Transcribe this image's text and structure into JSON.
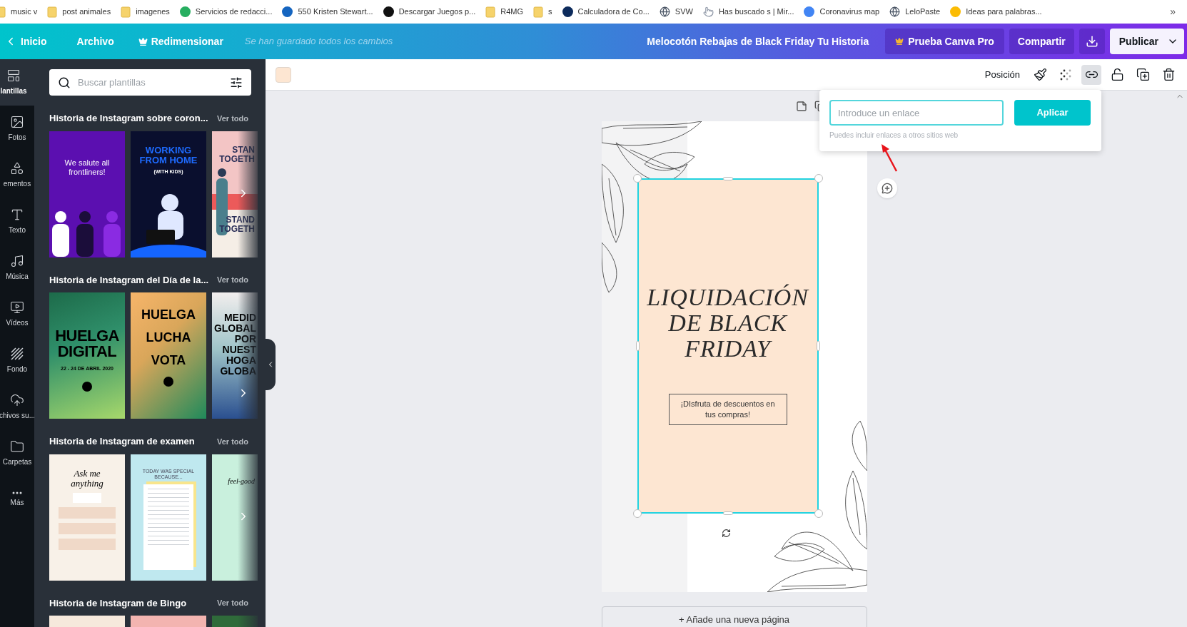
{
  "bookmarks": [
    {
      "label": "music v",
      "kind": "folder"
    },
    {
      "label": "post animales",
      "kind": "folder"
    },
    {
      "label": "imagenes",
      "kind": "folder"
    },
    {
      "label": "Servicios de redacci...",
      "kind": "dot",
      "color": "#27ae60"
    },
    {
      "label": "550 Kristen Stewart...",
      "kind": "dot",
      "color": "#1565c0"
    },
    {
      "label": "Descargar Juegos p...",
      "kind": "dot",
      "color": "#111111"
    },
    {
      "label": "R4MG",
      "kind": "folder"
    },
    {
      "label": "s",
      "kind": "folder"
    },
    {
      "label": "Calculadora de Co...",
      "kind": "dot",
      "color": "#0d2b5c"
    },
    {
      "label": "SVW",
      "kind": "globe"
    },
    {
      "label": "Has buscado s | Mir...",
      "kind": "pointer"
    },
    {
      "label": "Coronavirus map",
      "kind": "dot",
      "color": "#4285f4"
    },
    {
      "label": "LeloPaste",
      "kind": "globe"
    },
    {
      "label": "Ideas para palabras...",
      "kind": "dot",
      "color": "#fbbc04"
    }
  ],
  "bookmarks_more": "»",
  "topbar": {
    "back": "Inicio",
    "file": "Archivo",
    "resize": "Redimensionar",
    "status": "Se han guardado todos los cambios",
    "title": "Melocotón Rebajas de Black Friday Tu Historia",
    "pro": "Prueba Canva Pro",
    "share": "Compartir",
    "publish": "Publicar"
  },
  "rail": [
    {
      "label": "lantillas",
      "kind": "templates",
      "selected": true
    },
    {
      "label": "Fotos",
      "kind": "photos",
      "selected": false
    },
    {
      "label": "ementos",
      "kind": "elements",
      "selected": false
    },
    {
      "label": "Texto",
      "kind": "text",
      "selected": false
    },
    {
      "label": "Música",
      "kind": "music",
      "selected": false
    },
    {
      "label": "Vídeos",
      "kind": "video",
      "selected": false
    },
    {
      "label": "Fondo",
      "kind": "background",
      "selected": false
    },
    {
      "label": "chivos su...",
      "kind": "upload",
      "selected": false
    },
    {
      "label": "Carpetas",
      "kind": "folder",
      "selected": false
    },
    {
      "label": "Más",
      "kind": "more",
      "selected": false
    }
  ],
  "panel": {
    "search": {
      "placeholder": "Buscar plantillas"
    },
    "sections": [
      {
        "title": "Historia de Instagram sobre coron...",
        "link": "Ver todo",
        "thumbnails": [
          {
            "kind": "frontliners",
            "texts": [
              "We salute all frontliners!"
            ]
          },
          {
            "kind": "wfh",
            "texts": [
              "WORKING FROM HOME",
              "(WITH KIDS)"
            ]
          },
          {
            "kind": "stand",
            "texts": [
              "STAN",
              "TOGETH",
              "STAND",
              "TOGETH"
            ]
          }
        ]
      },
      {
        "title": "Historia de Instagram del Día de la...",
        "link": "Ver todo",
        "thumbnails": [
          {
            "kind": "huelga",
            "texts": [
              "HUELGA DIGITAL",
              "22 - 24 DE ABRIL 2020"
            ]
          },
          {
            "kind": "vota",
            "texts": [
              "HUELGA",
              "LUCHA",
              "VOTA"
            ]
          },
          {
            "kind": "medida",
            "texts": [
              "MEDID",
              "GLOBAL",
              "POR",
              "NUEST",
              "HOGA",
              "GLOBA"
            ]
          }
        ]
      },
      {
        "title": "Historia de Instagram de examen",
        "link": "Ver todo",
        "thumbnails": [
          {
            "kind": "ask",
            "texts": [
              "Ask me anything"
            ]
          },
          {
            "kind": "special",
            "texts": [
              "TODAY WAS SPECIAL BECAUSE..."
            ]
          },
          {
            "kind": "topten",
            "texts": [
              "feel-good"
            ]
          }
        ]
      },
      {
        "title": "Historia de Instagram de Bingo",
        "link": "Ver todo",
        "thumbnails": [
          {
            "kind": "peach"
          },
          {
            "kind": "pink"
          },
          {
            "kind": "green"
          }
        ]
      }
    ]
  },
  "toolbar": {
    "color": "#fde6d2",
    "position": "Posición",
    "tools": [
      {
        "kind": "paint-roller",
        "selected": false
      },
      {
        "kind": "transparency",
        "selected": false
      },
      {
        "kind": "link",
        "selected": true
      },
      {
        "kind": "lock",
        "selected": false
      },
      {
        "kind": "duplicate",
        "selected": false
      },
      {
        "kind": "trash",
        "selected": false
      }
    ]
  },
  "link_popover": {
    "placeholder": "Introduce un enlace",
    "button": "Aplicar",
    "hint": "Puedes incluir enlaces a otros sitios web"
  },
  "design": {
    "title_lines": [
      "LIQUIDACIÓN",
      "DE BLACK",
      "FRIDAY"
    ],
    "subtitle": "¡DIsfruta de descuentos en tus compras!",
    "add_page": "+ Añade una nueva página"
  }
}
